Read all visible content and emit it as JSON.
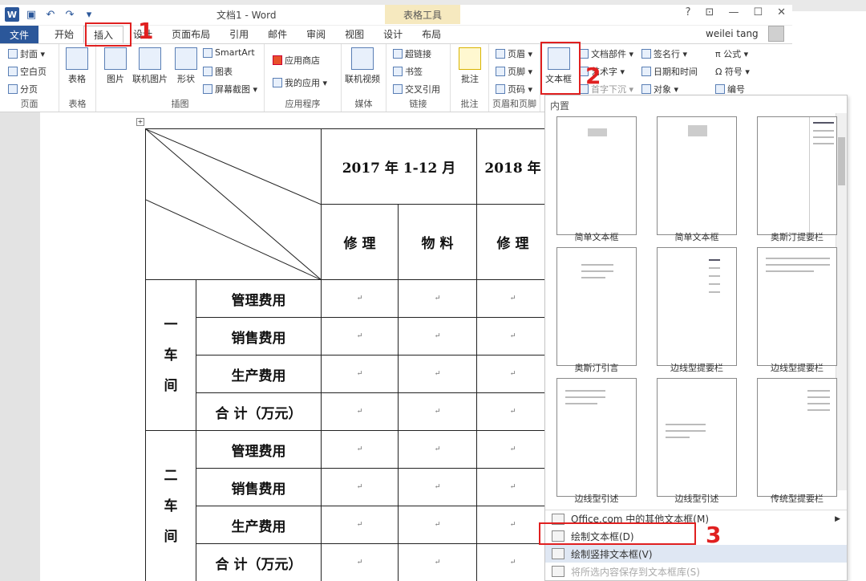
{
  "app": {
    "title": "文档1 - Word",
    "context_tab_group": "表格工具",
    "user": "weilei tang"
  },
  "window_buttons": [
    "?",
    "⊡",
    "—",
    "☐",
    "✕"
  ],
  "menu": {
    "file": "文件",
    "tabs": [
      "开始",
      "插入",
      "设计",
      "页面布局",
      "引用",
      "邮件",
      "审阅",
      "视图",
      "设计",
      "布局"
    ],
    "active": "插入"
  },
  "ribbon": {
    "pages": {
      "label": "页面",
      "items": [
        "封面 ▾",
        "空白页",
        "分页"
      ]
    },
    "tables": {
      "label": "表格",
      "button": "表格"
    },
    "illustrations": {
      "label": "插图",
      "buttons": [
        "图片",
        "联机图片",
        "形状"
      ],
      "items": [
        "SmartArt",
        "图表",
        "屏幕截图 ▾"
      ]
    },
    "apps": {
      "label": "应用程序",
      "items": [
        "应用商店",
        "我的应用 ▾"
      ]
    },
    "media": {
      "label": "媒体",
      "button": "联机视频"
    },
    "links": {
      "label": "链接",
      "items": [
        "超链接",
        "书签",
        "交叉引用"
      ]
    },
    "comments": {
      "label": "批注",
      "button": "批注"
    },
    "header_footer": {
      "label": "页眉和页脚",
      "items": [
        "页眉 ▾",
        "页脚 ▾",
        "页码 ▾"
      ]
    },
    "text": {
      "textbox": "文本框",
      "items": [
        "文档部件 ▾",
        "艺术字 ▾",
        "首字下沉 ▾"
      ],
      "items2": [
        "签名行 ▾",
        "日期和时间",
        "对象 ▾"
      ]
    },
    "symbols": {
      "items": [
        "π 公式 ▾",
        "Ω 符号 ▾",
        "编号"
      ]
    }
  },
  "annotations": {
    "n1": "1",
    "n2": "2",
    "n3": "3"
  },
  "table": {
    "header_2017": "2017 年 1-12 月",
    "header_2018": "2018 年",
    "sub": [
      "修 理",
      "物 料",
      "修 理"
    ],
    "groups": [
      {
        "name": "一\n车\n间",
        "rows": [
          "管理费用",
          "销售费用",
          "生产费用",
          "合 计（万元）"
        ]
      },
      {
        "name": "二\n车\n间",
        "rows": [
          "管理费用",
          "销售费用",
          "生产费用",
          "合 计（万元）"
        ]
      }
    ],
    "mark": "↵"
  },
  "gallery": {
    "heading": "内置",
    "items": [
      "简单文本框",
      "简单文本框",
      "奥斯汀提要栏",
      "奥斯汀引言",
      "边线型提要栏",
      "边线型提要栏",
      "边线型引述",
      "边线型引述",
      "传统型提要栏"
    ],
    "menu": [
      "Office.com 中的其他文本框(M)",
      "绘制文本框(D)",
      "绘制竖排文本框(V)",
      "将所选内容保存到文本框库(S)"
    ]
  }
}
